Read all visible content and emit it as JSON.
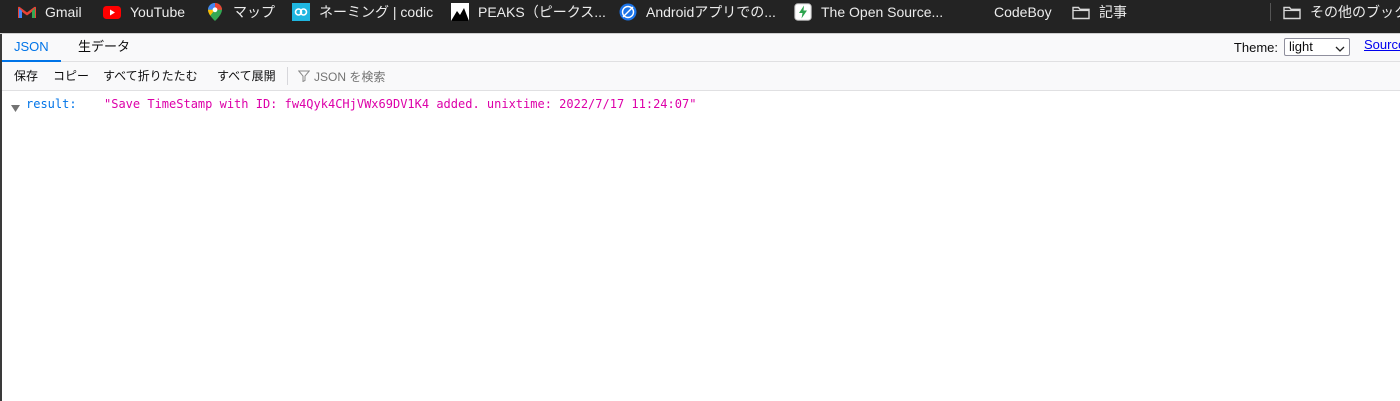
{
  "bookmarks": [
    {
      "label": "Gmail",
      "icon": "gmail-icon"
    },
    {
      "label": "YouTube",
      "icon": "youtube-icon"
    },
    {
      "label": "マップ",
      "icon": "maps-pin-icon"
    },
    {
      "label": "ネーミング | codic",
      "icon": "codic-icon"
    },
    {
      "label": "PEAKS（ピークス...",
      "icon": "peaks-icon"
    },
    {
      "label": "Androidアプリでの...",
      "icon": "globe-icon"
    },
    {
      "label": "The Open Source...",
      "icon": "open-source-icon"
    },
    {
      "label": "CodeBoy",
      "icon": ""
    },
    {
      "label": "記事",
      "icon": "folder-icon"
    },
    {
      "label": "その他のブック",
      "icon": "folder-icon"
    }
  ],
  "tabs": {
    "json": "JSON",
    "raw": "生データ"
  },
  "theme": {
    "label": "Theme:",
    "selected": "light"
  },
  "source_link": "Source",
  "toolbar": {
    "save": "保存",
    "copy": "コピー",
    "collapse_all": "すべて折りたたむ",
    "expand_all": "すべて展開",
    "filter_placeholder": "JSON を検索"
  },
  "json_rows": [
    {
      "key": "result:",
      "value": "\"Save TimeStamp with ID: fw4Qyk4CHjVWx69DV1K4 added. unixtime: 2022/7/17 11:24:07\""
    }
  ],
  "colors": {
    "accent": "#0074e8",
    "string_value": "#dd00a9",
    "bookmark_bar": "#232323"
  }
}
